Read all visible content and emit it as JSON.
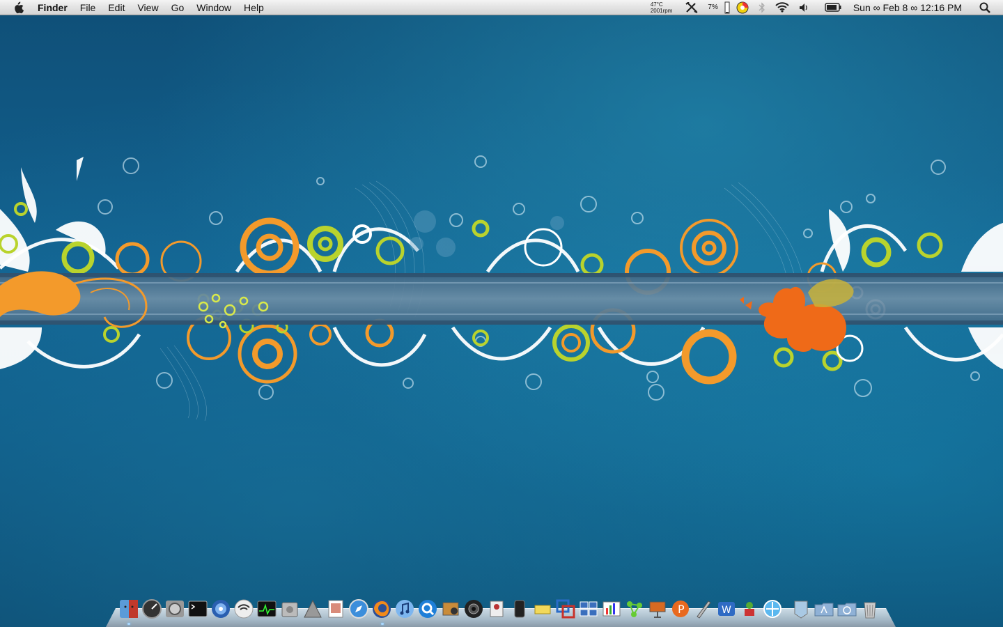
{
  "menubar": {
    "app_name": "Finder",
    "menus": [
      "File",
      "Edit",
      "View",
      "Go",
      "Window",
      "Help"
    ],
    "extras": {
      "temperature": "47°C",
      "fan_speed": "2001rpm",
      "cpu_percent": "7%",
      "clock": "Sun ∞ Feb 8 ∞ 12:16 PM"
    }
  },
  "dock": {
    "apps": [
      {
        "name": "Finder",
        "icon": "finder-icon"
      },
      {
        "name": "Dashboard",
        "icon": "dashboard-icon"
      },
      {
        "name": "System Preferences",
        "icon": "system-preferences-icon"
      },
      {
        "name": "Terminal",
        "icon": "terminal-icon"
      },
      {
        "name": "Time Machine",
        "icon": "time-machine-icon"
      },
      {
        "name": "AirPort Utility",
        "icon": "wifi-icon"
      },
      {
        "name": "Activity Monitor",
        "icon": "activity-monitor-icon"
      },
      {
        "name": "Disk Utility",
        "icon": "disk-utility-icon"
      },
      {
        "name": "Automator",
        "icon": "automator-icon"
      },
      {
        "name": "Preview",
        "icon": "preview-icon"
      },
      {
        "name": "Safari",
        "icon": "safari-icon"
      },
      {
        "name": "Firefox",
        "icon": "firefox-icon"
      },
      {
        "name": "iTunes",
        "icon": "itunes-icon"
      },
      {
        "name": "QuickTime",
        "icon": "quicktime-icon"
      },
      {
        "name": "iPhoto",
        "icon": "iphoto-icon"
      },
      {
        "name": "Aperture",
        "icon": "camera-lens-icon"
      },
      {
        "name": "Address Book",
        "icon": "address-book-icon"
      },
      {
        "name": "Device",
        "icon": "device-icon"
      },
      {
        "name": "Stickies",
        "icon": "stickies-icon"
      },
      {
        "name": "VMware Fusion",
        "icon": "vmware-icon"
      },
      {
        "name": "Spaces",
        "icon": "spaces-icon"
      },
      {
        "name": "Grapher",
        "icon": "grapher-icon"
      },
      {
        "name": "Network",
        "icon": "network-icon"
      },
      {
        "name": "Keynote",
        "icon": "keynote-icon"
      },
      {
        "name": "PowerPoint",
        "icon": "powerpoint-icon"
      },
      {
        "name": "Script Editor",
        "icon": "script-editor-icon"
      },
      {
        "name": "Word",
        "icon": "word-icon"
      },
      {
        "name": "Game",
        "icon": "game-icon"
      },
      {
        "name": "Web App",
        "icon": "web-app-icon"
      }
    ],
    "stacks": [
      {
        "name": "Documents",
        "icon": "documents-stack-icon"
      },
      {
        "name": "Applications",
        "icon": "applications-folder-icon"
      },
      {
        "name": "Downloads",
        "icon": "downloads-folder-icon"
      },
      {
        "name": "Trash",
        "icon": "trash-icon"
      }
    ]
  },
  "colors": {
    "wallpaper_base": "#126392",
    "accent_orange": "#f39a2b",
    "accent_lime": "#b9d32d",
    "band": "#5a7f99"
  }
}
